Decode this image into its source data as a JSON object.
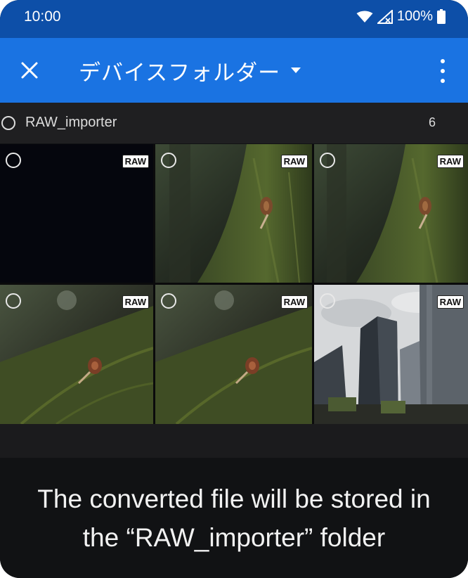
{
  "status_bar": {
    "time": "10:00",
    "battery": "100%",
    "icons": [
      "wifi-icon",
      "signal-icon",
      "battery-icon"
    ]
  },
  "app_bar": {
    "close_icon": "close-icon",
    "title": "デバイスフォルダー",
    "dropdown_icon": "chevron-down-icon",
    "menu_icon": "more-vert-icon"
  },
  "folder": {
    "name": "RAW_importer",
    "count": "6"
  },
  "photos": [
    {
      "badge": "RAW",
      "subject": "dark"
    },
    {
      "badge": "RAW",
      "subject": "snail-on-mossy-trunk"
    },
    {
      "badge": "RAW",
      "subject": "snail-on-mossy-trunk"
    },
    {
      "badge": "RAW",
      "subject": "snail-on-mossy-trunk"
    },
    {
      "badge": "RAW",
      "subject": "snail-on-mossy-trunk"
    },
    {
      "badge": "RAW",
      "subject": "skyscrapers"
    }
  ],
  "caption": {
    "line1": "The converted file will be stored in",
    "line2": "the “RAW_importer” folder"
  },
  "colors": {
    "status_bar": "#0d4fa8",
    "app_bar": "#1a73e2",
    "background": "#111214"
  }
}
